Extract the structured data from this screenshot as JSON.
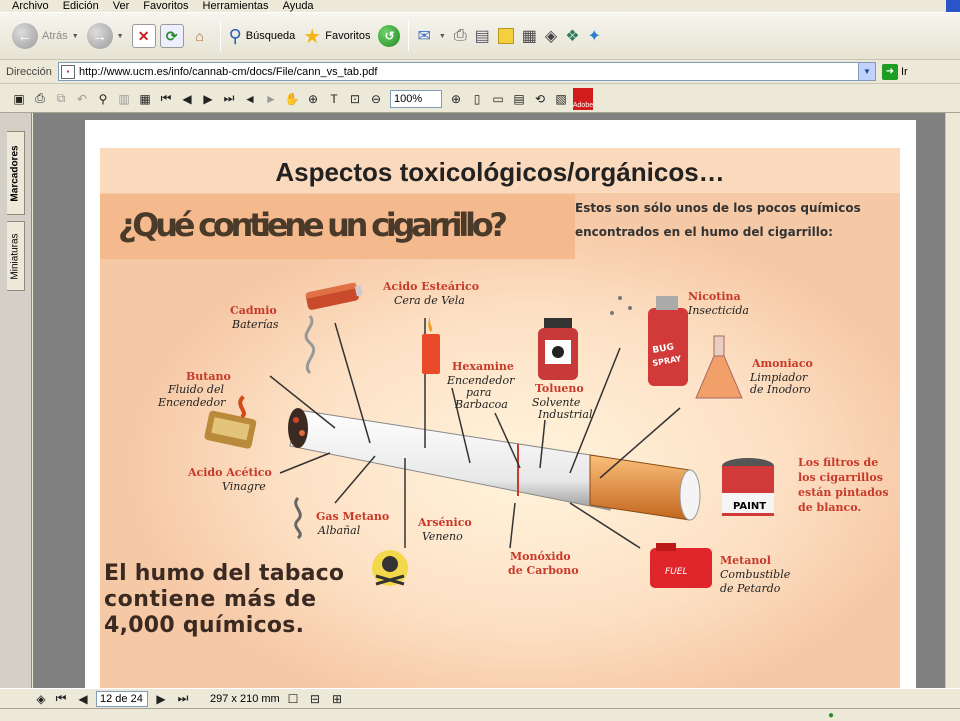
{
  "menu": [
    "Archivo",
    "Edición",
    "Ver",
    "Favoritos",
    "Herramientas",
    "Ayuda"
  ],
  "toolbar": {
    "back": "Atrás",
    "search": "Búsqueda",
    "favorites": "Favoritos"
  },
  "address": {
    "label": "Dirección",
    "url": "http://www.ucm.es/info/cannab-cm/docs/File/cann_vs_tab.pdf",
    "go": "Ir"
  },
  "pdf": {
    "zoom": "100%",
    "adobe": "Adobe"
  },
  "sidebar": {
    "tab1": "Marcadores",
    "tab2": "Miniaturas"
  },
  "bottom": {
    "page": "12 de 24",
    "size": "297 x 210 mm"
  },
  "slide": {
    "title": "Aspectos toxicológicos/orgánicos…",
    "question": "¿Qué contiene un cigarrillo?",
    "intro": [
      "Estos son sólo unos de los pocos químicos",
      "encontrados en el humo del cigarrillo:"
    ],
    "labels": {
      "cadmio": [
        "Cadmio",
        "Baterías"
      ],
      "estearico": [
        "Acido Esteárico",
        "Cera de Vela"
      ],
      "nicotina": [
        "Nicotina",
        "Insecticida"
      ],
      "hexamine": [
        "Hexamine",
        "Encendedor",
        "para",
        "Barbacoa"
      ],
      "tolueno": [
        "Tolueno",
        "Solvente",
        "Industrial"
      ],
      "amoniaco": [
        "Amoniaco",
        "Limpiador",
        "de Inodoro"
      ],
      "butano": [
        "Butano",
        "Fluido del",
        "Encendedor"
      ],
      "acetico": [
        "Acido Acético",
        "Vinagre"
      ],
      "filtros": [
        "Los filtros de",
        "los cigarrillos",
        "están pintados",
        "de blanco."
      ],
      "metano": [
        "Gas Metano",
        "Albañal"
      ],
      "arsenico": [
        "Arsénico",
        "Veneno"
      ],
      "monoxido": [
        "Monóxido",
        "de Carbono"
      ],
      "metanol": [
        "Metanol",
        "Combustible",
        "de Petardo"
      ]
    },
    "bottom_text": [
      "El humo del tabaco",
      "contiene más de",
      "4,000 químicos."
    ],
    "can": {
      "bug": "BUG",
      "spray": "SPRAY",
      "paint": "PAINT",
      "fuel": "FUEL"
    }
  }
}
